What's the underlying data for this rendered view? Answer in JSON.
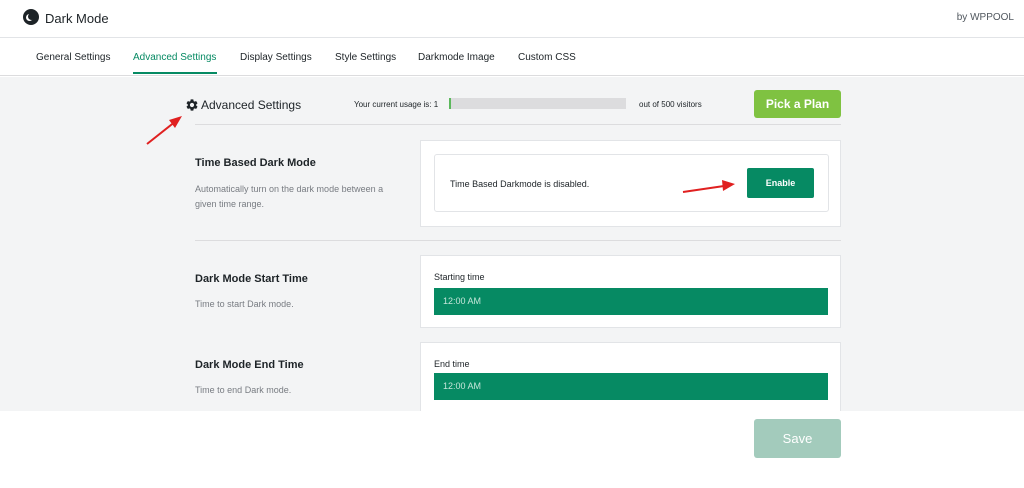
{
  "app": {
    "title": "Dark Mode",
    "brand": "by WPPOOL"
  },
  "tabs": [
    {
      "label": "General Settings"
    },
    {
      "label": "Advanced Settings"
    },
    {
      "label": "Display Settings"
    },
    {
      "label": "Style Settings"
    },
    {
      "label": "Darkmode Image"
    },
    {
      "label": "Custom CSS"
    }
  ],
  "active_tab": "Advanced Settings",
  "header": {
    "title": "Advanced Settings",
    "usage_label": "Your current usage is: 1",
    "usage_suffix": "out of 500 visitors",
    "usage_fraction": 0.002,
    "plan_button": "Pick a Plan"
  },
  "time_based": {
    "title": "Time Based Dark Mode",
    "description": "Automatically turn on the dark mode between a given time range.",
    "status": "Time Based Darkmode is disabled.",
    "enable_button": "Enable"
  },
  "start_time": {
    "title": "Dark Mode Start Time",
    "description": "Time to start Dark mode.",
    "field_label": "Starting time",
    "value": "12:00 AM"
  },
  "end_time": {
    "title": "Dark Mode End Time",
    "description": "Time to end Dark mode.",
    "field_label": "End time",
    "value": "12:00 AM"
  },
  "footer": {
    "save_button": "Save"
  },
  "colors": {
    "accent": "#068a63",
    "plan_button": "#7fc241",
    "save_button_disabled": "#a3cbbc",
    "annotation_arrow": "#e02020"
  },
  "icons": [
    "moon-logo-icon",
    "gear-icon",
    "red-arrow-annotation"
  ]
}
